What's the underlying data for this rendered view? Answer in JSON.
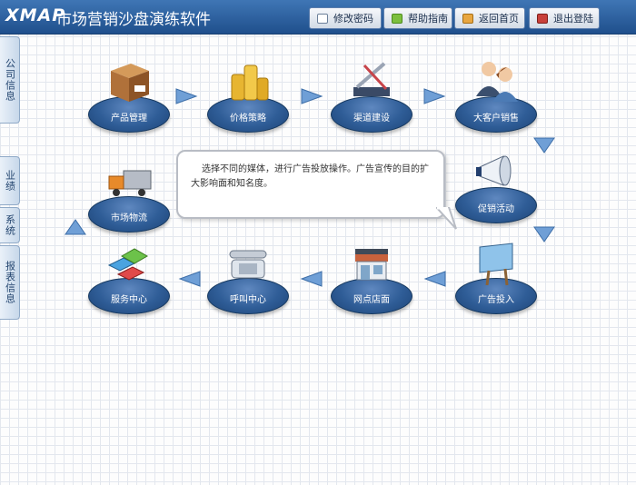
{
  "header": {
    "logo": "XMAP",
    "title": "市场营销沙盘演练软件",
    "buttons": [
      {
        "label": "修改密码",
        "icon": "envelope-icon"
      },
      {
        "label": "帮助指南",
        "icon": "help-icon"
      },
      {
        "label": "返回首页",
        "icon": "home-icon"
      },
      {
        "label": "退出登陆",
        "icon": "exit-icon"
      }
    ]
  },
  "sidebar": {
    "tabs": [
      {
        "label": "公司信息"
      },
      {
        "label": "业绩"
      },
      {
        "label": "系统"
      },
      {
        "label": "报表信息"
      }
    ]
  },
  "flow": {
    "nodes": [
      {
        "label": "产品管理",
        "icon": "product-box-icon"
      },
      {
        "label": "价格策略",
        "icon": "coins-icon"
      },
      {
        "label": "渠道建设",
        "icon": "tools-icon"
      },
      {
        "label": "大客户销售",
        "icon": "customers-icon"
      },
      {
        "label": "市场物流",
        "icon": "truck-icon"
      },
      {
        "label": "促销活动",
        "icon": "megaphone-icon"
      },
      {
        "label": "服务中心",
        "icon": "service-blocks-icon"
      },
      {
        "label": "呼叫中心",
        "icon": "telephone-icon"
      },
      {
        "label": "网点店面",
        "icon": "storefront-icon"
      },
      {
        "label": "广告投入",
        "icon": "billboard-icon"
      }
    ],
    "tooltip": "选择不同的媒体，进行广告投放操作。广告宣传的目的扩大影响面和知名度。"
  },
  "colors": {
    "header_top": "#3f76b5",
    "header_bottom": "#1f4f8c",
    "node_pad": "#2f5d97",
    "arrow": "#6f9fd6"
  }
}
